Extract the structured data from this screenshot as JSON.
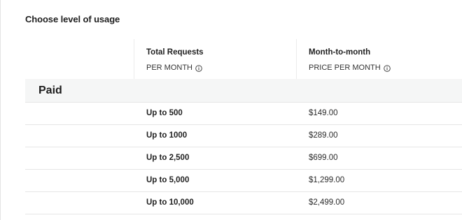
{
  "page": {
    "heading": "Choose level of usage"
  },
  "table": {
    "col_requests": {
      "title": "Total Requests",
      "subtitle": "PER MONTH",
      "info_icon": "info-icon"
    },
    "col_price": {
      "title": "Month-to-month",
      "subtitle": "PRICE PER MONTH",
      "info_icon": "info-icon"
    },
    "section": {
      "label": "Paid"
    },
    "rows": [
      {
        "requests": "Up to 500",
        "price": "$149.00"
      },
      {
        "requests": "Up to 1000",
        "price": "$289.00"
      },
      {
        "requests": "Up to 2,500",
        "price": "$699.00"
      },
      {
        "requests": "Up to 5,000",
        "price": "$1,299.00"
      },
      {
        "requests": "Up to 10,000",
        "price": "$2,499.00"
      }
    ]
  }
}
